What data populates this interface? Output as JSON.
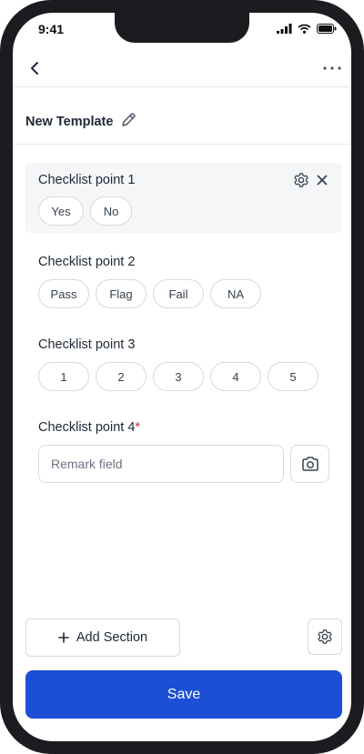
{
  "status_bar": {
    "time": "9:41"
  },
  "header": {
    "title": "New Template"
  },
  "checklist": [
    {
      "label": "Checklist point 1",
      "options": [
        "Yes",
        "No"
      ]
    },
    {
      "label": "Checklist point 2",
      "options": [
        "Pass",
        "Flag",
        "Fail",
        "NA"
      ]
    },
    {
      "label": "Checklist point 3",
      "options": [
        "1",
        "2",
        "3",
        "4",
        "5"
      ]
    },
    {
      "label": "Checklist point 4",
      "required_mark": "*",
      "remark_placeholder": "Remark field"
    }
  ],
  "footer": {
    "add_section_label": "Add Section",
    "save_label": "Save"
  },
  "colors": {
    "primary": "#1c4fd6",
    "required": "#dc2626",
    "selected_block_bg": "#f4f6f8"
  },
  "icons": [
    "back-icon",
    "more-icon",
    "edit-icon",
    "gear-icon",
    "close-icon",
    "camera-icon",
    "plus-icon"
  ]
}
